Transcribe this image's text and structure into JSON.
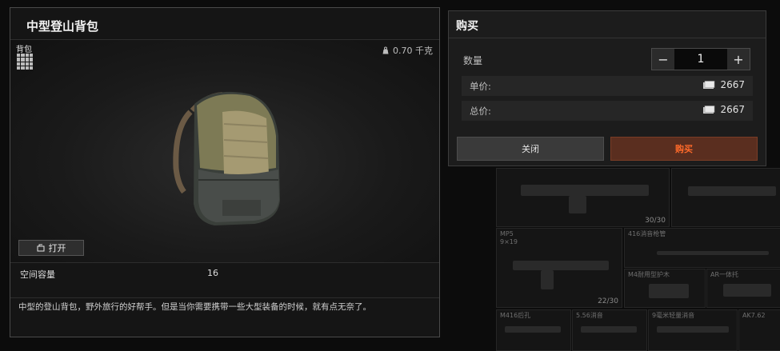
{
  "item": {
    "title": "中型登山背包",
    "category": "背包",
    "weight": "0.70 千克",
    "open_label": "打开",
    "stat_label": "空间容量",
    "stat_value": "16",
    "description": "中型的登山背包，野外旅行的好帮手。但是当你需要携带一些大型装备的时候，就有点无奈了。"
  },
  "buy": {
    "title": "购买",
    "quantity_label": "数量",
    "quantity": "1",
    "minus": "−",
    "plus": "+",
    "unit_price_label": "单价:",
    "unit_price": "2667",
    "total_price_label": "总价:",
    "total_price": "2667",
    "close_label": "关闭",
    "buy_label": "购买"
  },
  "background_grid": {
    "cells": [
      {
        "label": "",
        "count": "30/30"
      },
      {
        "label": "MP5\n9×19",
        "count": "22/30"
      },
      {
        "label": "416消音枪管",
        "count": ""
      },
      {
        "label": "M4耐用型护木",
        "count": ""
      },
      {
        "label": "AR一体托",
        "count": ""
      },
      {
        "label": "M416后孔",
        "count": ""
      },
      {
        "label": "5.56消音",
        "count": ""
      },
      {
        "label": "9毫米轻量消音",
        "count": ""
      },
      {
        "label": "AK7.62",
        "count": ""
      }
    ]
  },
  "colors": {
    "accent": "#ff6a2a",
    "buy_bg": "#5a2e1f"
  }
}
